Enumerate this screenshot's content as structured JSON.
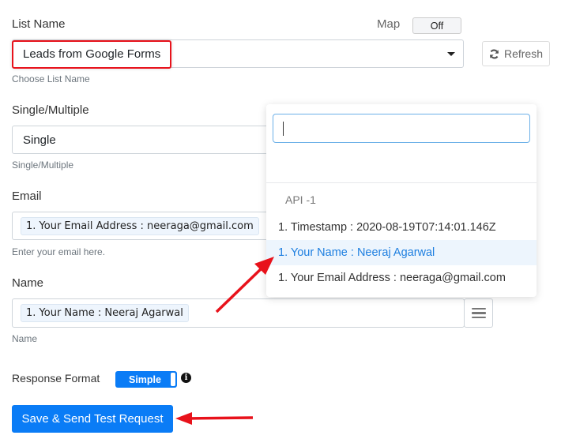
{
  "list_name": {
    "label": "List Name",
    "value": "Leads from Google Forms",
    "help": "Choose List Name",
    "map_label": "Map",
    "map_toggle": "Off",
    "refresh_label": "Refresh"
  },
  "single_multiple": {
    "label": "Single/Multiple",
    "value": "Single",
    "help": "Single/Multiple"
  },
  "email": {
    "label": "Email",
    "value": "1. Your Email Address : neeraga@gmail.com",
    "help": "Enter your email here."
  },
  "name": {
    "label": "Name",
    "value": "1. Your Name : Neeraj Agarwal",
    "help": "Name"
  },
  "dropdown": {
    "search_value": "",
    "group_label": "API -1",
    "options": [
      {
        "label": "1. Timestamp : 2020-08-19T07:14:01.146Z"
      },
      {
        "label": "1. Your Name : Neeraj Agarwal",
        "active": true
      },
      {
        "label": "1. Your Email Address : neeraga@gmail.com"
      }
    ]
  },
  "response_format": {
    "label": "Response Format",
    "toggle": "Simple"
  },
  "save_button": "Save & Send Test Request",
  "colors": {
    "accent": "#0a7cf6",
    "annotation": "#e8121b",
    "active_option": "#1e7fe0"
  }
}
